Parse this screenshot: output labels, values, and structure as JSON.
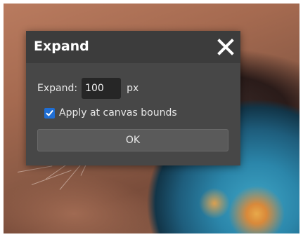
{
  "dialog": {
    "title": "Expand",
    "close_icon": "close-icon",
    "expand_label": "Expand:",
    "expand_value": "100",
    "unit": "px",
    "apply_bounds_label": "Apply at canvas bounds",
    "apply_bounds_checked": true,
    "ok_label": "OK"
  },
  "colors": {
    "dialog_bg": "#474747",
    "titlebar_bg": "#3c3c3c",
    "input_bg": "#262626",
    "checkbox_accent": "#1f6ed4",
    "button_bg": "#5a5a5a"
  }
}
